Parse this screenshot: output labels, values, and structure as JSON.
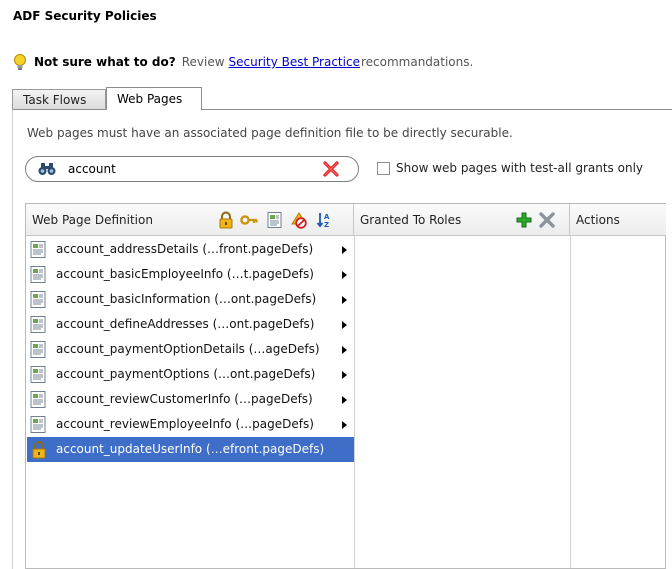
{
  "page": {
    "title": "ADF Security Policies",
    "hint_strong": "Not sure what to do?",
    "hint_pre": "Review",
    "hint_link": "Security Best Practice",
    "hint_post": "recommandations."
  },
  "tabs": [
    {
      "label": "Task Flows",
      "selected": false
    },
    {
      "label": "Web Pages",
      "selected": true
    }
  ],
  "description": "Web pages must have an associated page definition file to be directly securable.",
  "search": {
    "value": "account",
    "placeholder": ""
  },
  "filter": {
    "label": "Show web pages with test-all grants only",
    "checked": false
  },
  "table": {
    "col_definition": "Web Page Definition",
    "col_roles": "Granted To Roles",
    "col_actions": "Actions",
    "rows": [
      {
        "label": "account_addressDetails (…front.pageDefs)",
        "icon": "page-def-icon",
        "selected": false
      },
      {
        "label": "account_basicEmployeeInfo (…t.pageDefs)",
        "icon": "page-def-icon",
        "selected": false
      },
      {
        "label": "account_basicInformation (…ont.pageDefs)",
        "icon": "page-def-icon",
        "selected": false
      },
      {
        "label": "account_defineAddresses (…ont.pageDefs)",
        "icon": "page-def-icon",
        "selected": false
      },
      {
        "label": "account_paymentOptionDetails (…ageDefs)",
        "icon": "page-def-icon",
        "selected": false
      },
      {
        "label": "account_paymentOptions (…ont.pageDefs)",
        "icon": "page-def-icon",
        "selected": false
      },
      {
        "label": "account_reviewCustomerInfo (…pageDefs)",
        "icon": "page-def-icon",
        "selected": false
      },
      {
        "label": "account_reviewEmployeeInfo (…pageDefs)",
        "icon": "page-def-icon",
        "selected": false
      },
      {
        "label": "account_updateUserInfo (…efront.pageDefs)",
        "icon": "lock-icon",
        "selected": true
      }
    ]
  },
  "colors": {
    "selection": "#3e6ec8",
    "link": "#0000cc",
    "add": "#2aa82a",
    "clear": "#e02020"
  }
}
